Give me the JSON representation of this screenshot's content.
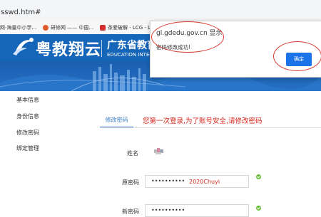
{
  "browser": {
    "url": "sswd.htm#",
    "bookmarks": [
      {
        "label": "网-海量中小学...",
        "color": "#8a8a8a"
      },
      {
        "label": "研修网 —— 中国...",
        "color": "#e05a2b"
      },
      {
        "label": "茶爱破解 - LCG - L",
        "color": "#d32f2f"
      }
    ]
  },
  "header": {
    "brand": "粤教翔云",
    "org_cn": "广东省教育",
    "org_en": "EDUCATION INTEG"
  },
  "sidebar": {
    "items": [
      {
        "label": "基本信息"
      },
      {
        "label": "身份信息"
      },
      {
        "label": "修改密码"
      },
      {
        "label": "绑定管理"
      }
    ]
  },
  "main": {
    "tab": "修改密码",
    "notice": "您第一次登录,为了账号安全,请修改密码"
  },
  "form": {
    "name_label": "姓名",
    "old_password_label": "原密码",
    "old_password_mask": "••••••••••",
    "old_password_value": "2020Chuyi",
    "new_password_label": "新密码",
    "new_password_mask": "••••••••••"
  },
  "dialog": {
    "title": "gl.gdedu.gov.cn 显示",
    "message": "密码修改成功!",
    "ok_label": "确定"
  },
  "colors": {
    "brand_blue": "#1565b8",
    "notice_red": "#d8261b",
    "annotation_red": "#d63b30",
    "ok_blue": "#1a73e8",
    "check_green": "#6bbf3c"
  }
}
